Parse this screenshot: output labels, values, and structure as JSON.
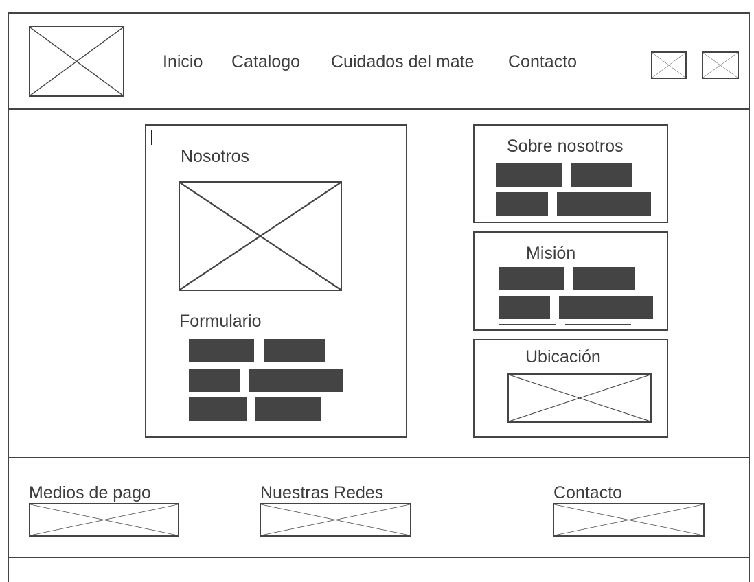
{
  "header": {
    "nav": [
      "Inicio",
      "Catalogo",
      "Cuidados del mate",
      "Contacto"
    ]
  },
  "main": {
    "nosotros": {
      "title": "Nosotros",
      "form_title": "Formulario"
    },
    "sobre": {
      "title": "Sobre nosotros"
    },
    "mision": {
      "title": "Misión"
    },
    "ubicacion": {
      "title": "Ubicación"
    }
  },
  "footer": {
    "medios": "Medios de pago",
    "redes": "Nuestras Redes",
    "contacto": "Contacto"
  },
  "icons": {
    "placeholder": "image-placeholder-icon"
  },
  "colors": {
    "line": "#444444",
    "block": "#444444",
    "background": "#ffffff"
  }
}
